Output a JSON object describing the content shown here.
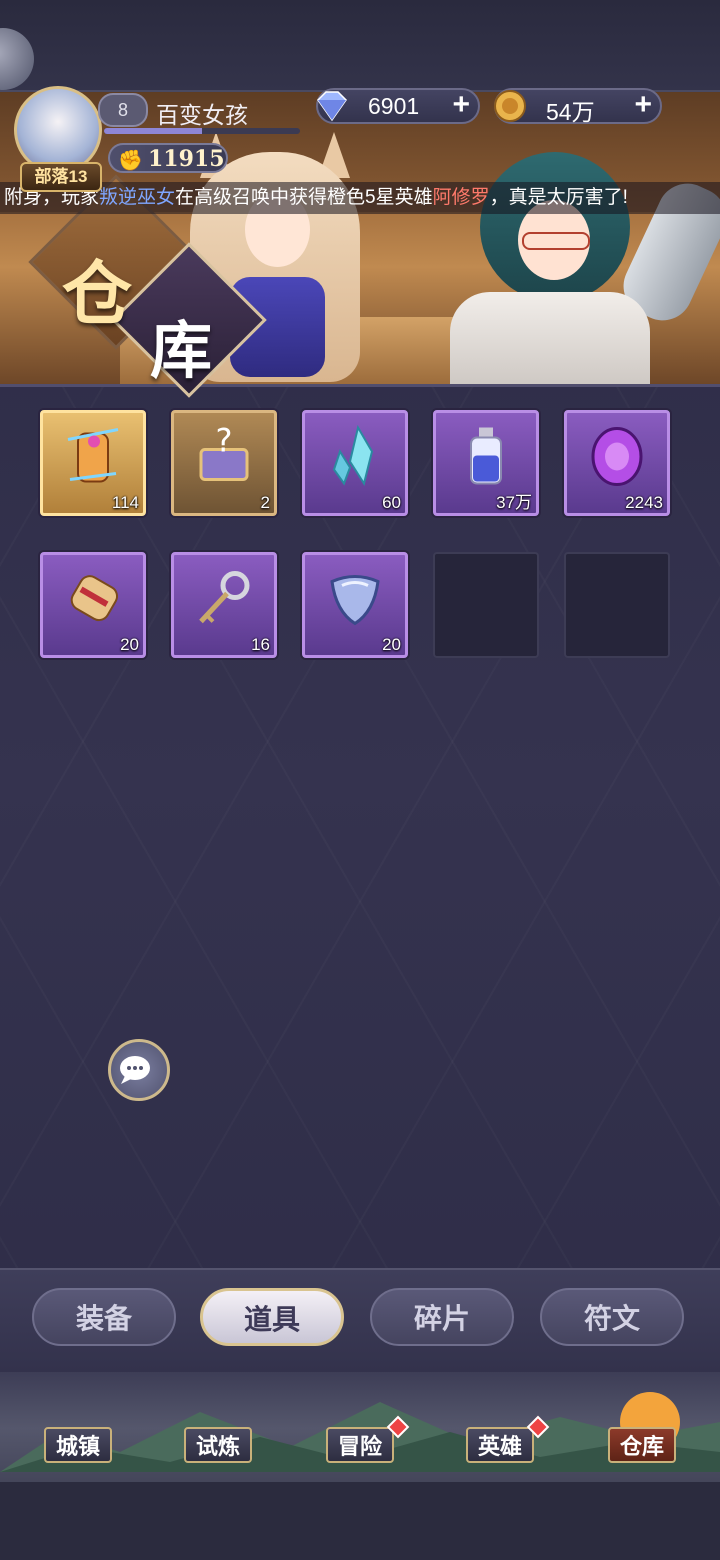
{
  "header": {
    "level": "8",
    "player_name": "百变女孩",
    "tribe_label": "部落13",
    "xp_fraction": 0.5,
    "power": "11915",
    "gems": "6901",
    "gold": "54万",
    "gems_plus": "+",
    "gold_plus": "+"
  },
  "banner": {
    "title_char_1": "仓",
    "title_char_2": "库",
    "marquee": {
      "prefix": "附身，玩家",
      "player": "叛逆巫女",
      "middle": "在高级召唤中获得橙色5星英雄",
      "hero": "阿修罗",
      "suffix": "，真是太厉害了!"
    }
  },
  "items": [
    {
      "name": "summon-scroll-legendary",
      "count": "114",
      "frame": "gold"
    },
    {
      "name": "mystery-chest",
      "count": "2",
      "frame": "gold2"
    },
    {
      "name": "crystal-shards",
      "count": "60",
      "frame": "purple"
    },
    {
      "name": "exp-potion",
      "count": "37万",
      "frame": "purple"
    },
    {
      "name": "purple-gem",
      "count": "2243",
      "frame": "purple"
    },
    {
      "name": "summon-scroll-common",
      "count": "20",
      "frame": "purple"
    },
    {
      "name": "key",
      "count": "16",
      "frame": "purple"
    },
    {
      "name": "shield-stone",
      "count": "20",
      "frame": "purple"
    },
    {
      "name": "empty-slot",
      "count": "",
      "frame": "empty"
    },
    {
      "name": "empty-slot",
      "count": "",
      "frame": "empty"
    }
  ],
  "tabs": [
    {
      "label": "装备",
      "active": false
    },
    {
      "label": "道具",
      "active": true
    },
    {
      "label": "碎片",
      "active": false
    },
    {
      "label": "符文",
      "active": false
    }
  ],
  "nav": [
    {
      "label": "城镇",
      "badge": false,
      "active": false
    },
    {
      "label": "试炼",
      "badge": false,
      "active": false
    },
    {
      "label": "冒险",
      "badge": true,
      "active": false
    },
    {
      "label": "英雄",
      "badge": true,
      "active": false
    },
    {
      "label": "仓库",
      "badge": false,
      "active": true
    }
  ],
  "colors": {
    "highlight_player": "#7fa6ff",
    "highlight_hero": "#ff7a6b",
    "badge": "#e44444"
  }
}
